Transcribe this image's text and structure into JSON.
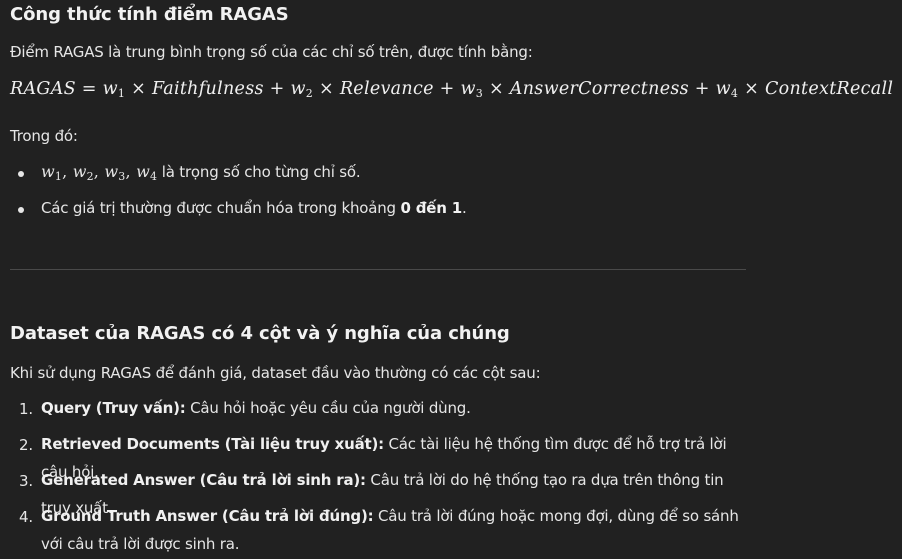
{
  "section1": {
    "heading": "Công thức tính điểm RAGAS",
    "intro": "Điểm RAGAS là trung bình trọng số của các chỉ số trên, được tính bằng:",
    "formula": {
      "lhs": "RAGAS",
      "eq": "=",
      "plus": "+",
      "times": "×",
      "w": "w",
      "idx1": "1",
      "idx2": "2",
      "idx3": "3",
      "idx4": "4",
      "term1": "Faithfulness",
      "term2": "Relevance",
      "term3": "AnswerCorrectness",
      "term4": "ContextRecall"
    },
    "where_label": "Trong đó:",
    "bullets": {
      "b1_text": "là trọng số cho từng chỉ số.",
      "b2_prefix": "Các giá trị thường được chuẩn hóa trong khoảng ",
      "b2_bold": "0 đến 1",
      "b2_suffix": "."
    }
  },
  "section2": {
    "heading": "Dataset của RAGAS có 4 cột và ý nghĩa của chúng",
    "intro": "Khi sử dụng RAGAS để đánh giá, dataset đầu vào thường có các cột sau:",
    "items": [
      {
        "num": "1.",
        "term": "Query (Truy vấn):",
        "desc": " Câu hỏi hoặc yêu cầu của người dùng."
      },
      {
        "num": "2.",
        "term": "Retrieved Documents (Tài liệu truy xuất):",
        "desc": " Các tài liệu hệ thống tìm được để hỗ trợ trả lời câu hỏi."
      },
      {
        "num": "3.",
        "term": "Generated Answer (Câu trả lời sinh ra):",
        "desc": " Câu trả lời do hệ thống tạo ra dựa trên thông tin truy xuất."
      },
      {
        "num": "4.",
        "term": "Ground Truth Answer (Câu trả lời đúng):",
        "desc": " Câu trả lời đúng hoặc mong đợi, dùng để so sánh với câu trả lời được sinh ra."
      }
    ]
  }
}
